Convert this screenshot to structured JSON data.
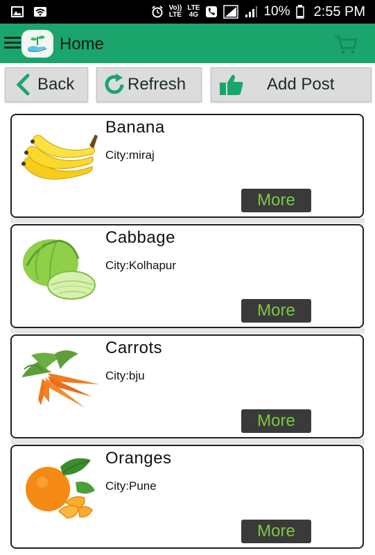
{
  "status_bar": {
    "volte_top": "Vo))",
    "volte_bottom": "LTE",
    "lte_top": "LTE",
    "lte_bottom": "4G",
    "battery": "10%",
    "time": "2:55 PM"
  },
  "app_bar": {
    "title": "Home"
  },
  "toolbar": {
    "back_label": "Back",
    "refresh_label": "Refresh",
    "add_post_label": "Add Post"
  },
  "items": [
    {
      "name": "Banana",
      "city": "City:miraj",
      "more_label": "More",
      "icon": "banana-image"
    },
    {
      "name": "Cabbage",
      "city": "City:Kolhapur",
      "more_label": "More",
      "icon": "cabbage-image"
    },
    {
      "name": "Carrots",
      "city": "City:bju",
      "more_label": "More",
      "icon": "carrots-image"
    },
    {
      "name": "Oranges",
      "city": "City:Pune",
      "more_label": "More",
      "icon": "oranges-image"
    }
  ],
  "colors": {
    "app_bar": "#1aa56d",
    "more_text": "#7ac943",
    "more_bg": "#3a3a3a"
  }
}
